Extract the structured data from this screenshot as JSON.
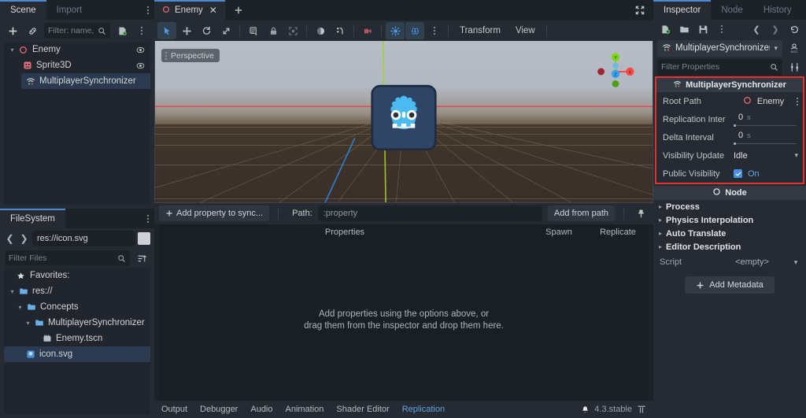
{
  "scene_dock": {
    "tabs": [
      {
        "label": "Scene",
        "active": true
      },
      {
        "label": "Import",
        "active": false
      }
    ],
    "toolbar": {
      "add_node_icon": "plus-icon",
      "instantiate_icon": "link-icon",
      "filter_placeholder": "Filter: name, t:t",
      "search_icon": "search-icon",
      "attach_script_icon": "script-icon",
      "menu_icon": "vertical-dots-icon"
    },
    "tree": [
      {
        "label": "Enemy",
        "icon": "node3d-icon",
        "depth": 0,
        "expanded": true,
        "selected": false,
        "visibility_icon": "eye-icon"
      },
      {
        "label": "Sprite3D",
        "icon": "sprite3d-icon",
        "depth": 1,
        "expanded": null,
        "selected": false,
        "visibility_icon": "eye-icon"
      },
      {
        "label": "MultiplayerSynchronizer",
        "icon": "multiplayer-sync-icon",
        "depth": 1,
        "expanded": null,
        "selected": true,
        "visibility_icon": ""
      }
    ]
  },
  "filesystem_dock": {
    "tabs": [
      {
        "label": "FileSystem",
        "active": true
      }
    ],
    "path": "res://icon.svg",
    "back_icon": "chevron-left-icon",
    "forward_icon": "chevron-right-icon",
    "filter_placeholder": "Filter Files",
    "search_icon": "search-icon",
    "sort_icon": "sort-icon",
    "tree": [
      {
        "label": "Favorites:",
        "icon": "star-icon",
        "depth": 0,
        "expanded": null,
        "selected": false
      },
      {
        "label": "res://",
        "icon": "folder-icon",
        "depth": 0,
        "expanded": true,
        "selected": false
      },
      {
        "label": "Concepts",
        "icon": "folder-icon",
        "depth": 1,
        "expanded": true,
        "selected": false
      },
      {
        "label": "MultiplayerSynchronizer",
        "icon": "folder-icon",
        "depth": 2,
        "expanded": true,
        "selected": false
      },
      {
        "label": "Enemy.tscn",
        "icon": "scene-icon",
        "depth": 3,
        "expanded": null,
        "selected": false
      },
      {
        "label": "icon.svg",
        "icon": "image-icon",
        "depth": 2,
        "expanded": null,
        "selected": true
      }
    ]
  },
  "scene_tabs": {
    "tabs": [
      {
        "label": "Enemy",
        "icon": "node3d-icon",
        "close_icon": "close-icon",
        "active": true
      }
    ],
    "add_tab_icon": "plus-icon",
    "maximize_icon": "maximize-icon"
  },
  "viewport_toolbar": {
    "buttons": [
      {
        "name": "select-mode",
        "icon": "cursor-icon",
        "active": true
      },
      {
        "name": "move-mode",
        "icon": "move-icon",
        "active": false
      },
      {
        "name": "rotate-mode",
        "icon": "rotate-icon",
        "active": false
      },
      {
        "name": "scale-mode",
        "icon": "scale-icon",
        "active": false
      },
      {
        "name": "list-select",
        "icon": "list-select-icon",
        "active": false
      },
      {
        "name": "lock-selection",
        "icon": "lock-icon",
        "active": false
      },
      {
        "name": "group-selection",
        "icon": "group-icon",
        "active": false
      },
      {
        "name": "local-space",
        "icon": "sphere-icon",
        "active": false
      },
      {
        "name": "snap-mode",
        "icon": "snap-icon",
        "active": false
      },
      {
        "name": "camera-preview",
        "icon": "camera-icon",
        "active": false
      },
      {
        "name": "preview-sun",
        "icon": "sun-icon",
        "active": true
      },
      {
        "name": "preview-environment",
        "icon": "globe-icon",
        "active": true
      },
      {
        "name": "viewport-menu",
        "icon": "vertical-dots-icon",
        "active": false
      }
    ],
    "menus": [
      {
        "label": "Transform"
      },
      {
        "label": "View"
      }
    ]
  },
  "viewport": {
    "perspective_label": "Perspective",
    "perspective_menu_icon": "vertical-dots-icon",
    "gizmo": {
      "x_label": "X",
      "y_label": "Y",
      "z_label": "Z",
      "x_color": "#ff4a4a",
      "y_color": "#7fd41a",
      "z_color": "#3aa3f0"
    },
    "axis_colors": {
      "x_axis": "#f0405a",
      "y_axis": "#a4d22a",
      "z_axis": "#2f83e0",
      "grid": "#8b8578"
    },
    "sprite_icon": "godot-logo-icon"
  },
  "replication": {
    "add_property_label": "Add property to sync...",
    "add_property_icon": "plus-icon",
    "path_label": "Path:",
    "path_value": ":property",
    "add_from_path_label": "Add from path",
    "pin_icon": "pin-icon",
    "columns": [
      "Properties",
      "Spawn",
      "Replicate"
    ],
    "empty_line1": "Add properties using the options above, or",
    "empty_line2": "drag them from the inspector and drop them here."
  },
  "status_bar": {
    "items": [
      {
        "label": "Output",
        "active": false
      },
      {
        "label": "Debugger",
        "active": false
      },
      {
        "label": "Audio",
        "active": false
      },
      {
        "label": "Animation",
        "active": false
      },
      {
        "label": "Shader Editor",
        "active": false
      },
      {
        "label": "Replication",
        "active": true
      }
    ],
    "version": "4.3.stable",
    "bell_icon": "bell-icon",
    "layout_icon": "expand-bottom-icon"
  },
  "inspector": {
    "tabs": [
      {
        "label": "Inspector",
        "active": true
      },
      {
        "label": "Node",
        "active": false
      },
      {
        "label": "History",
        "active": false
      }
    ],
    "toolbar": {
      "new_resource_icon": "new-file-icon",
      "load_icon": "folder-open-icon",
      "save_icon": "save-icon",
      "tools_icon": "vertical-dots-icon",
      "back_icon": "chevron-left-icon",
      "forward_icon": "chevron-right-icon",
      "history_icon": "history-icon"
    },
    "selected_node": {
      "label": "MultiplayerSynchronizer",
      "icon": "multiplayer-sync-icon",
      "chevron_icon": "chevron-down-icon",
      "docs_icon": "doc-icon"
    },
    "filter_placeholder": "Filter Properties",
    "search_icon": "search-icon",
    "settings_icon": "tools-icon",
    "highlight_color": "#e5342c",
    "category": {
      "label": "MultiplayerSynchronizer",
      "icon": "multiplayer-sync-icon"
    },
    "properties": [
      {
        "name": "Root Path",
        "type": "object",
        "value": "Enemy",
        "icon": "node3d-icon",
        "menu_icon": "vertical-dots-icon"
      },
      {
        "name": "Replication Inter",
        "type": "slider",
        "value": "0",
        "unit": "s"
      },
      {
        "name": "Delta Interval",
        "type": "slider",
        "value": "0",
        "unit": "s"
      },
      {
        "name": "Visibility Update",
        "type": "enum",
        "value": "Idle",
        "chevron_icon": "chevron-down-icon"
      },
      {
        "name": "Public Visibility",
        "type": "bool",
        "value": "On",
        "checked": true
      }
    ],
    "node_category": {
      "label": "Node",
      "icon": "node-icon"
    },
    "sections": [
      {
        "label": "Process",
        "expanded": false
      },
      {
        "label": "Physics Interpolation",
        "expanded": false
      },
      {
        "label": "Auto Translate",
        "expanded": false
      },
      {
        "label": "Editor Description",
        "expanded": false
      }
    ],
    "script_row": {
      "name": "Script",
      "value": "<empty>",
      "chevron_icon": "chevron-down-icon"
    },
    "add_metadata": {
      "label": "Add Metadata",
      "icon": "plus-icon"
    }
  }
}
